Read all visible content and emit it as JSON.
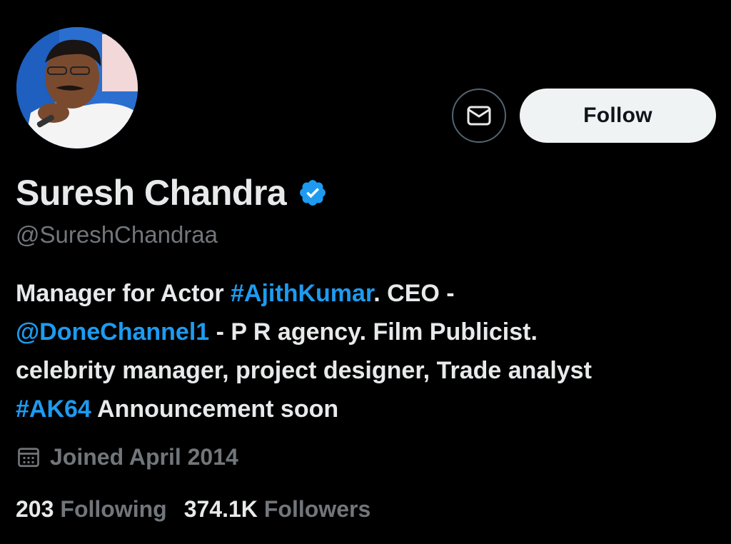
{
  "profile": {
    "name": "Suresh Chandra",
    "handle": "@SureshChandraa",
    "verified_icon": "verified-badge-icon",
    "accent_color": "#1d9bf0"
  },
  "actions": {
    "message_icon": "envelope-icon",
    "follow_label": "Follow"
  },
  "bio": {
    "line1": {
      "t1": "Manager for Actor ",
      "link1": "#AjithKumar",
      "t2": ". CEO -"
    },
    "line2": {
      "link1": "@DoneChannel1",
      "t2": " - P R agency. Film Publicist."
    },
    "line3": {
      "t1": "celebrity manager, project designer, Trade analyst"
    },
    "line4": {
      "link1": "#AK64",
      "t2": " Announcement soon"
    }
  },
  "joined": {
    "icon": "calendar-icon",
    "text": "Joined April 2014"
  },
  "stats": {
    "following_count": "203",
    "following_label": "Following",
    "followers_count": "374.1K",
    "followers_label": "Followers"
  }
}
